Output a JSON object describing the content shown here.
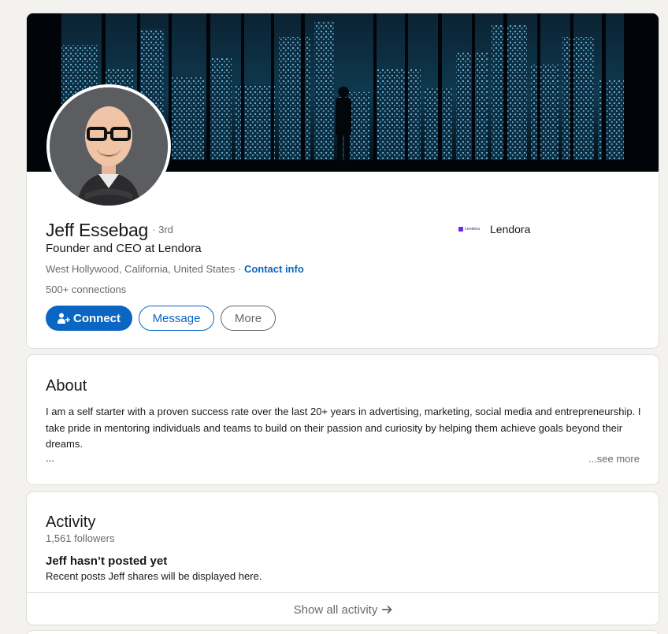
{
  "profile": {
    "name": "Jeff Essebag",
    "degree": "· 3rd",
    "headline": "Founder and CEO at Lendora",
    "location": "West Hollywood, California, United States",
    "location_separator": " · ",
    "contact_info": "Contact info",
    "connections": "500+ connections",
    "company": {
      "name": "Lendora",
      "logo_text": "Lendora",
      "logo_color": "#6b2bd9"
    },
    "actions": {
      "connect": "Connect",
      "message": "Message",
      "more": "More"
    },
    "icons": {
      "connect_icon": "add-person-icon"
    }
  },
  "about": {
    "title": "About",
    "text": "I am a self starter with a proven success rate over the last 20+ years in advertising, marketing, social media and entrepreneurship. I take pride in mentoring individuals and teams to build on their passion and curiosity by helping them achieve goals beyond their dreams.",
    "ellipsis": "...",
    "see_more": "...see more"
  },
  "activity": {
    "title": "Activity",
    "followers": "1,561 followers",
    "empty_title": "Jeff hasn’t posted yet",
    "empty_subtitle": "Recent posts Jeff shares will be displayed here.",
    "show_all": "Show all activity",
    "show_all_icon": "arrow-right-icon"
  },
  "colors": {
    "accent": "#0a66c2",
    "background": "#f3f2ef",
    "card_border": "#e0dfdc"
  }
}
